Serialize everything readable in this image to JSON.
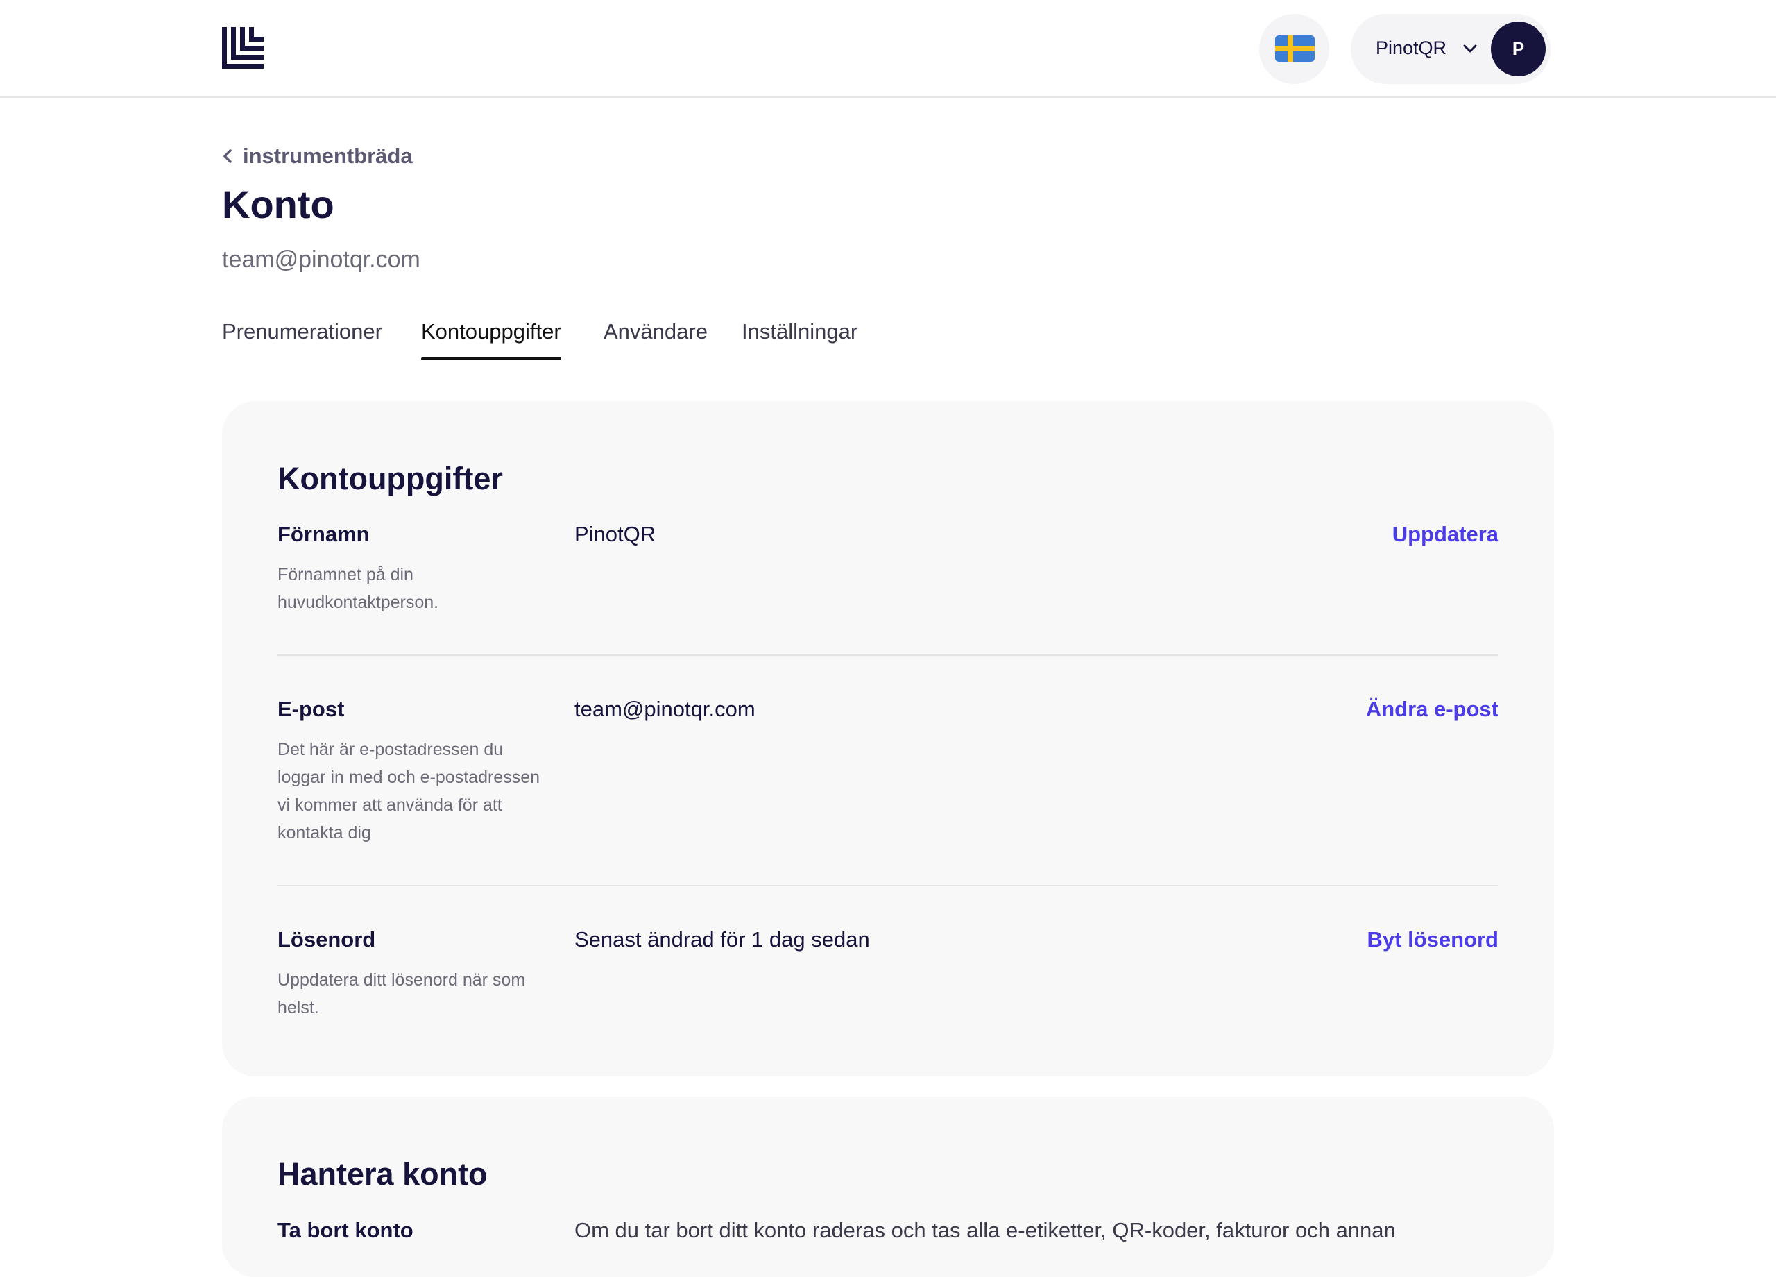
{
  "header": {
    "language_flag": "sweden-flag-icon",
    "account_name": "PinotQR",
    "avatar_initial": "P"
  },
  "breadcrumb": {
    "back_label": "instrumentbräda"
  },
  "page": {
    "title": "Konto",
    "email": "team@pinotqr.com"
  },
  "tabs": [
    {
      "label": "Prenumerationer",
      "active": false
    },
    {
      "label": "Kontouppgifter",
      "active": true
    },
    {
      "label": "Användare",
      "active": false
    },
    {
      "label": "Inställningar",
      "active": false
    }
  ],
  "account_details": {
    "title": "Kontouppgifter",
    "rows": [
      {
        "label": "Förnamn",
        "description": "Förnamnet på din huvudkontaktperson.",
        "value": "PinotQR",
        "action": "Uppdatera"
      },
      {
        "label": "E-post",
        "description": "Det här är e-postadressen du loggar in med och e-postadressen vi kommer att använda för att kontakta dig",
        "value": "team@pinotqr.com",
        "action": "Ändra e-post"
      },
      {
        "label": "Lösenord",
        "description": "Uppdatera ditt lösenord när som helst.",
        "value": "Senast ändrad för 1 dag sedan",
        "action": "Byt lösenord"
      }
    ]
  },
  "manage_account": {
    "title": "Hantera konto",
    "delete_label": "Ta bort konto",
    "delete_text": "Om du tar bort ditt konto raderas och tas alla e-etiketter, QR-koder, fakturor och annan"
  },
  "colors": {
    "brand_navy": "#16133d",
    "action_link": "#4b3be8",
    "card_bg": "#f8f8f8"
  }
}
